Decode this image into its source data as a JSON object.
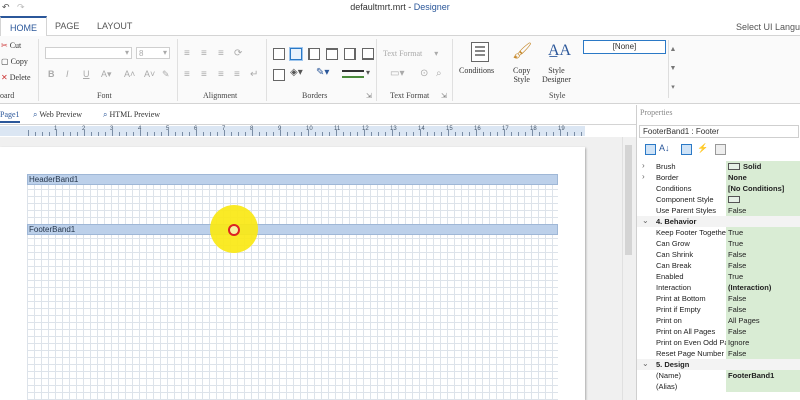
{
  "window": {
    "filename": "defaultmrt.mrt",
    "sep": " - ",
    "app": "Designer"
  },
  "quick_access": {
    "undo": "↶",
    "redo": "↷"
  },
  "tabs": [
    "HOME",
    "PAGE",
    "LAYOUT"
  ],
  "select_ui_hint": "Select UI Langu",
  "clipboard": {
    "cut": "Cut",
    "copy": "Copy",
    "delete": "Delete",
    "group_label": "oard"
  },
  "font": {
    "size_value": "8",
    "group_label": "Font"
  },
  "alignment": {
    "group_label": "Alignment"
  },
  "borders": {
    "group_label": "Borders"
  },
  "text_format": {
    "label": "Text Format",
    "group_label": "Text Format"
  },
  "style": {
    "conditions": "Conditions",
    "copy_style_1": "Copy",
    "copy_style_2": "Style",
    "style_designer_1": "Style",
    "style_designer_2": "Designer",
    "selector": "[None]",
    "group_label": "Style"
  },
  "doc_tabs": {
    "page": "Page1",
    "web": "Web Preview",
    "html": "HTML Preview"
  },
  "ruler": [
    "1",
    "2",
    "3",
    "4",
    "5",
    "6",
    "7",
    "8",
    "9",
    "10",
    "11",
    "12",
    "13",
    "14",
    "15",
    "16",
    "17",
    "18",
    "19"
  ],
  "bands": {
    "header": "HeaderBand1",
    "footer": "FooterBand1"
  },
  "properties": {
    "title": "Properties",
    "selected": "FooterBand1 : Footer",
    "rows": [
      {
        "exp": "›",
        "name": "Brush",
        "value": "Solid",
        "bold": true,
        "swatch": true
      },
      {
        "exp": "›",
        "name": "Border",
        "value": "None",
        "bold": true
      },
      {
        "name": "Conditions",
        "value": "[No Conditions]",
        "bold": true
      },
      {
        "name": "Component Style",
        "value": "",
        "swatch": true
      },
      {
        "name": "Use Parent Styles",
        "value": "False"
      },
      {
        "exp": "⌄",
        "name": "4. Behavior",
        "cat": true
      },
      {
        "name": "Keep Footer Together",
        "value": "True"
      },
      {
        "name": "Can Grow",
        "value": "True"
      },
      {
        "name": "Can Shrink",
        "value": "False"
      },
      {
        "name": "Can Break",
        "value": "False"
      },
      {
        "name": "Enabled",
        "value": "True"
      },
      {
        "name": "Interaction",
        "value": "(Interaction)",
        "bold": true
      },
      {
        "name": "Print at Bottom",
        "value": "False"
      },
      {
        "name": "Print if Empty",
        "value": "False"
      },
      {
        "name": "Print on",
        "value": "All Pages"
      },
      {
        "name": "Print on All Pages",
        "value": "False"
      },
      {
        "name": "Print on Even Odd Pages",
        "value": "Ignore"
      },
      {
        "name": "Reset Page Number",
        "value": "False"
      },
      {
        "exp": "⌄",
        "name": "5. Design",
        "cat": true
      },
      {
        "name": "(Name)",
        "value": "FooterBand1",
        "bold": true
      },
      {
        "name": "(Alias)",
        "value": ""
      }
    ]
  }
}
